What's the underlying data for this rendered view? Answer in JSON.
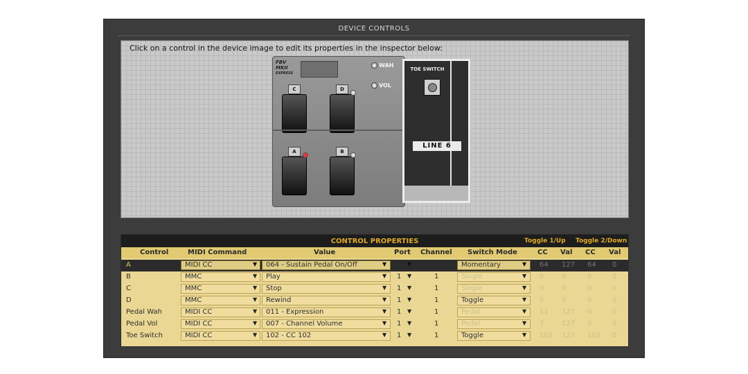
{
  "panel": {
    "title": "DEVICE CONTROLS",
    "instruction": "Click on a control in the device image to edit its properties in the inspector below:"
  },
  "device": {
    "logo": [
      "FBV",
      "MKII",
      "EXPRESS"
    ],
    "leds": [
      {
        "label": "WAH"
      },
      {
        "label": "VOL"
      }
    ],
    "switches": [
      {
        "label": "C",
        "led": "off"
      },
      {
        "label": "D",
        "led": "off"
      },
      {
        "label": "A",
        "led": "on"
      },
      {
        "label": "B",
        "led": "off"
      }
    ],
    "toe_switch_label": "TOE SWITCH",
    "brand": "LINE 6",
    "led_on_color": "#e33333"
  },
  "properties": {
    "title": "CONTROL PROPERTIES",
    "toggle1": "Toggle 1/Up",
    "toggle2": "Toggle 2/Down",
    "columns": [
      "Control",
      "MIDI Command",
      "Value",
      "Port",
      "Channel",
      "Switch Mode",
      "CC",
      "Val",
      "CC",
      "Val"
    ],
    "rows": [
      {
        "control": "A",
        "command": "MIDI CC",
        "value": "064 - Sustain Pedal On/Off",
        "port": "1",
        "channel": "1",
        "mode": "Momentary",
        "cc1": "64",
        "val1": "127",
        "cc2": "64",
        "val2": "0",
        "selected": true
      },
      {
        "control": "B",
        "command": "MMC",
        "value": "Play",
        "port": "1",
        "channel": "1",
        "mode": "Single",
        "cc1": "0",
        "val1": "0",
        "cc2": "0",
        "val2": "0",
        "selected": false
      },
      {
        "control": "C",
        "command": "MMC",
        "value": "Stop",
        "port": "1",
        "channel": "1",
        "mode": "Single",
        "cc1": "0",
        "val1": "0",
        "cc2": "0",
        "val2": "0",
        "selected": false
      },
      {
        "control": "D",
        "command": "MMC",
        "value": "Rewind",
        "port": "1",
        "channel": "1",
        "mode": "Toggle",
        "cc1": "0",
        "val1": "0",
        "cc2": "0",
        "val2": "0",
        "selected": false
      },
      {
        "control": "Pedal Wah",
        "command": "MIDI CC",
        "value": "011 - Expression",
        "port": "1",
        "channel": "1",
        "mode": "Pedal",
        "cc1": "11",
        "val1": "127",
        "cc2": "0",
        "val2": "0",
        "selected": false
      },
      {
        "control": "Pedal Vol",
        "command": "MIDI CC",
        "value": "007 - Channel Volume",
        "port": "1",
        "channel": "1",
        "mode": "Pedal",
        "cc1": "7",
        "val1": "127",
        "cc2": "0",
        "val2": "0",
        "selected": false
      },
      {
        "control": "Toe Switch",
        "command": "MIDI CC",
        "value": "102 - CC 102",
        "port": "1",
        "channel": "1",
        "mode": "Toggle",
        "cc1": "102",
        "val1": "127",
        "cc2": "102",
        "val2": "0",
        "selected": false
      }
    ]
  }
}
